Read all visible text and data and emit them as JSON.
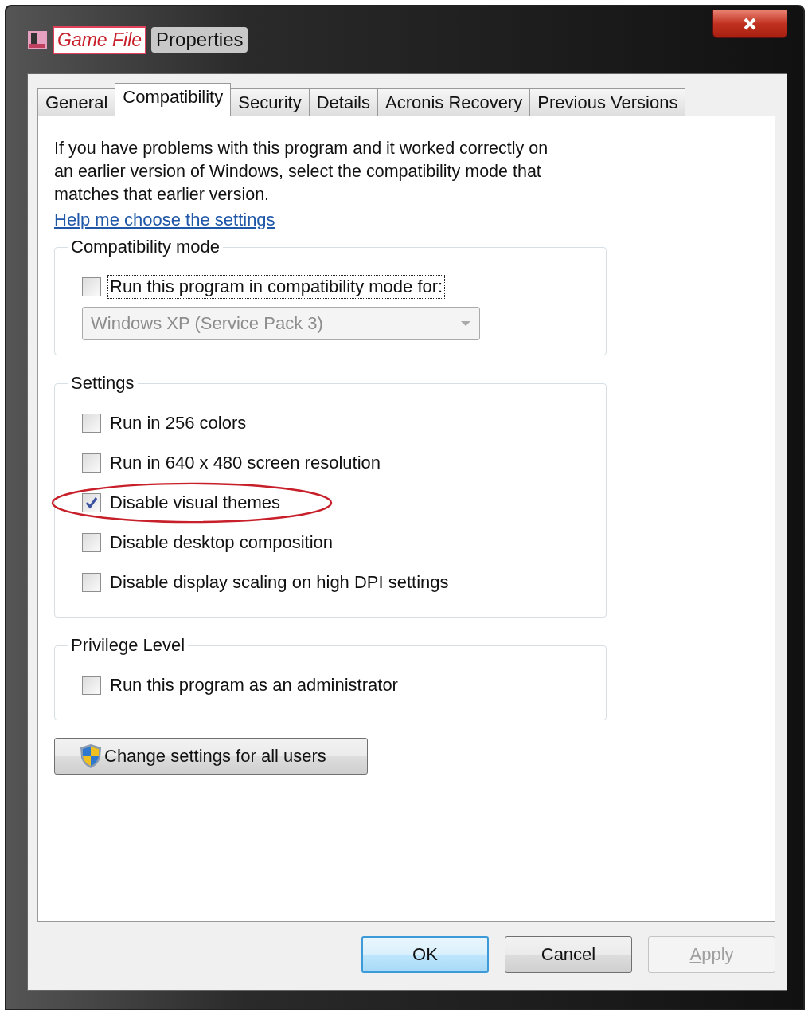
{
  "window": {
    "title_marked": "Game File",
    "title": "Properties"
  },
  "tabs": [
    {
      "label": "General",
      "selected": false
    },
    {
      "label": "Compatibility",
      "selected": true
    },
    {
      "label": "Security",
      "selected": false
    },
    {
      "label": "Details",
      "selected": false
    },
    {
      "label": "Acronis Recovery",
      "selected": false
    },
    {
      "label": "Previous Versions",
      "selected": false
    }
  ],
  "intro": "If you have problems with this program and it worked correctly on an earlier version of Windows, select the compatibility mode that matches that earlier version.",
  "help_link": "Help me choose the settings",
  "groups": [
    {
      "title": "Compatibility mode",
      "items": [
        {
          "label": "Run this program in compatibility mode for:",
          "checked": false,
          "focused": true,
          "highlighted": false
        }
      ],
      "dropdown": {
        "value": "Windows XP (Service Pack 3)",
        "disabled": true
      }
    },
    {
      "title": "Settings",
      "items": [
        {
          "label": "Run in 256 colors",
          "checked": false,
          "focused": false,
          "highlighted": false
        },
        {
          "label": "Run in 640 x 480 screen resolution",
          "checked": false,
          "focused": false,
          "highlighted": false
        },
        {
          "label": "Disable visual themes",
          "checked": true,
          "focused": false,
          "highlighted": true
        },
        {
          "label": "Disable desktop composition",
          "checked": false,
          "focused": false,
          "highlighted": false
        },
        {
          "label": "Disable display scaling on high DPI settings",
          "checked": false,
          "focused": false,
          "highlighted": false
        }
      ]
    },
    {
      "title": "Privilege Level",
      "items": [
        {
          "label": "Run this program as an administrator",
          "checked": false,
          "focused": false,
          "highlighted": false
        }
      ]
    }
  ],
  "change_button": "Change settings for all users",
  "buttons": [
    {
      "label": "OK",
      "default": true,
      "disabled": false
    },
    {
      "label": "Cancel",
      "default": false,
      "disabled": false
    },
    {
      "label": "Apply",
      "default": false,
      "disabled": true
    }
  ]
}
